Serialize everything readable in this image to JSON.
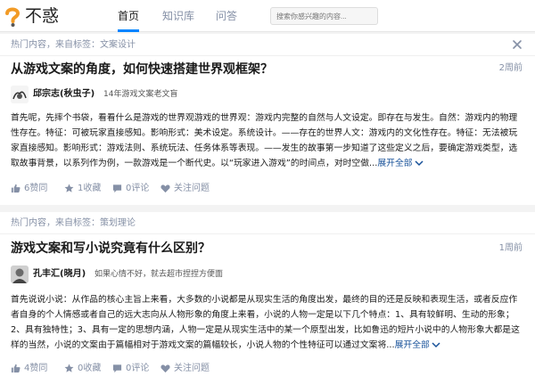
{
  "header": {
    "logo_text": "不惑",
    "nav": [
      "首页",
      "知识库",
      "问答"
    ],
    "search_placeholder": "搜索你感兴趣的内容..."
  },
  "colors": {
    "accent": "#0084ff",
    "link": "#175199",
    "meta": "#8590a6",
    "logo_orange": "#f29b26"
  },
  "feed": [
    {
      "topic_prefix": "热门内容，来自标签：",
      "topic": "文案设计",
      "title": "从游戏文案的角度，如何快速搭建世界观框架？",
      "time": "2周前",
      "author": "邱宗志(秋虫子)",
      "bio": "14年游戏文案老文盲",
      "excerpt": "首先呢，先摔个书袋，看看什么是游戏的世界观游戏的世界观：游戏内完整的自然与人文设定。即存在与发生。自然：游戏内的物理性存在。特征：可被玩家直接感知。影响形式：美术设定。系统设计。——存在的世界人文：游戏内的文化性存在。特征：无法被玩家直接感知。影响形式：游戏法则、系统玩法、任务体系等表现。——发生的故事第一步知道了这些定义之后，要确定游戏类型，选取故事背景，以系列作为例，一款游戏是一个断代史。以“玩家进入游戏”的时间点，对时空做...",
      "expand": "展开全部",
      "likes": "6赞同",
      "favorites": "1收藏",
      "comments": "0评论",
      "follow": "关注问题"
    },
    {
      "topic_prefix": "热门内容，来自标签：",
      "topic": "策划理论",
      "title": "游戏文案和写小说究竟有什么区别？",
      "time": "1周前",
      "author": "孔丰汇(晓月)",
      "bio": "如果心情不好，就去超市捏捏方便面",
      "excerpt": "首先说说小说：从作品的核心主旨上来看，大多数的小说都是从现实生活的角度出发，最终的目的还是反映和表现生活，或者反应作者自身的个人情感或者自己的远大志向从人物形象的角度上来看，小说的人物一定是以下几个特点：1、具有较鲜明、生动的形象；2、具有独特性；3、具有一定的思想内涵，人物一定是从现实生活中的某一个原型出发，比如鲁迅的短片小说中的人物形象大都是这样的当然，小说的文案由于篇幅相对于游戏文案的篇幅较长，小说人物的个性特征可以通过文案将...",
      "expand": "展开全部",
      "likes": "4赞同",
      "favorites": "0收藏",
      "comments": "0评论",
      "follow": "关注问题"
    }
  ]
}
